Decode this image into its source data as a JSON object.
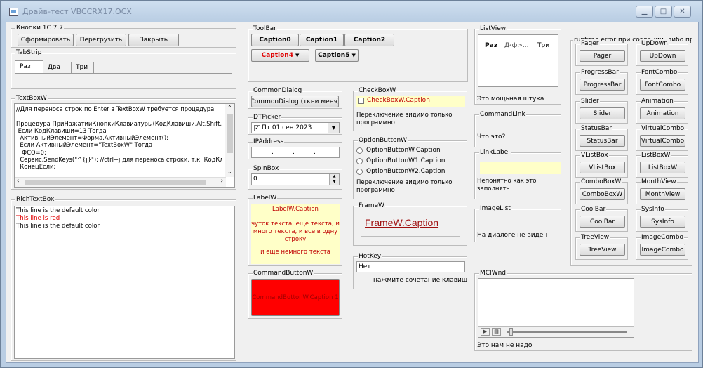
{
  "window": {
    "title": "Драйв-тест VBCCRX17.OCX"
  },
  "knopki": {
    "label": "Кнопки 1С 7.7",
    "buttons": [
      "Сформировать",
      "Перегрузить",
      "Закрыть"
    ]
  },
  "tabstrip": {
    "label": "TabStrip",
    "tabs": [
      "Раз",
      "Два",
      "Три"
    ]
  },
  "textbox": {
    "label": "TextBoxW",
    "lines": [
      "//Для переноса строк по Enter в TextBoxW требуется процедура",
      "",
      "Процедура ПриНажатииКнопкиКлавиатуры(КодКлавиши,Alt,Shift,Ct",
      " Если КодКлавиши=13 Тогда",
      "  АктивныйЭлемент=Форма.АктивныйЭлемент();",
      "  Если АктивныйЭлемент=\"TextBoxW\" Тогда",
      "   ФСО=0;",
      "  Сервис.SendKeys(\"^{j}\"); //ctrl+j для переноса строки, т.к. КодКла",
      "  КонецЕсли;"
    ]
  },
  "richtext": {
    "label": "RichTextBox",
    "lines": [
      {
        "text": "This line is the default color",
        "color": "#000000"
      },
      {
        "text": "This line is red",
        "color": "#e00000"
      },
      {
        "text": "This line is the default color",
        "color": "#000000"
      }
    ]
  },
  "toolbar": {
    "label": "ToolBar",
    "buttons": [
      {
        "text": "Caption0",
        "color": "#000000"
      },
      {
        "text": "Caption1",
        "color": "#000000"
      },
      {
        "text": "Caption2",
        "color": "#000000"
      },
      {
        "text": "Caption4",
        "color": "#e00000"
      },
      {
        "text": "Caption5",
        "color": "#000000"
      }
    ]
  },
  "commondialog": {
    "label": "CommonDialog",
    "button": "CommonDialog (ткни меня)"
  },
  "dtpicker": {
    "label": "DTPicker",
    "value": "Пт 01 сен  2023"
  },
  "ipaddress": {
    "label": "IPAddress"
  },
  "spinbox": {
    "label": "SpinBox",
    "value": "0"
  },
  "labelw": {
    "label": "LabelW",
    "caption": "LabelW.Caption",
    "text": "чуток текста, еще текста, и много текста, и все в одну строку",
    "text2": "и еще немного текста"
  },
  "commandbutton": {
    "label": "CommandButtonW",
    "caption": "CommandButtonW.Caption 1",
    "color": "#ff0000"
  },
  "checkbox": {
    "label": "CheckBoxW",
    "caption": "CheckBoxW.Caption",
    "note": "Переключение видимо только программно"
  },
  "optionbutton": {
    "label": "OptionButtonW",
    "options": [
      "OptionButtonW.Caption",
      "OptionButtonW1.Caption",
      "OptionButtonW2.Caption"
    ],
    "note": "Переключение видимо только программно"
  },
  "framew": {
    "label": "FrameW",
    "caption": "FrameW.Caption"
  },
  "hotkey": {
    "label": "HotKey",
    "value": "Нет",
    "note": "нажмите сочетание клавиш"
  },
  "listview": {
    "label": "ListView",
    "items": [
      "Раз",
      "Д‹ф>...",
      "Три"
    ],
    "note": "Это мощьная штука"
  },
  "commandlink": {
    "label": "CommandLink",
    "text": "Что это?"
  },
  "linklabel": {
    "label": "LinkLabel",
    "note": "Непонятно как это заполнять"
  },
  "imagelist": {
    "label": "ImageList",
    "note": "На диалоге не виден"
  },
  "mciwnd": {
    "label": "MCIWnd",
    "note": "Это нам не надо"
  },
  "right": {
    "label": "runtime error при создании, либо при пе",
    "groups": [
      {
        "label": "Pager",
        "button": "Pager"
      },
      {
        "label": "UpDown",
        "button": "UpDown"
      },
      {
        "label": "ProgressBar",
        "button": "ProgressBar"
      },
      {
        "label": "FontCombo",
        "button": "FontCombo"
      },
      {
        "label": "Slider",
        "button": "Slider"
      },
      {
        "label": "Animation",
        "button": "Animation"
      },
      {
        "label": "StatusBar",
        "button": "StatusBar"
      },
      {
        "label": "VirtualCombo",
        "button": "VirtualCombo"
      },
      {
        "label": "VListBox",
        "button": "VListBox"
      },
      {
        "label": "ListBoxW",
        "button": "ListBoxW"
      },
      {
        "label": "ComboBoxW",
        "button": "ComboBoxW"
      },
      {
        "label": "MonthView",
        "button": "MonthView"
      },
      {
        "label": "CoolBar",
        "button": "CoolBar"
      },
      {
        "label": "SysInfo",
        "button": "SysInfo"
      },
      {
        "label": "TreeView",
        "button": "TreeView"
      },
      {
        "label": "ImageCombo",
        "button": "ImageCombo"
      }
    ]
  }
}
